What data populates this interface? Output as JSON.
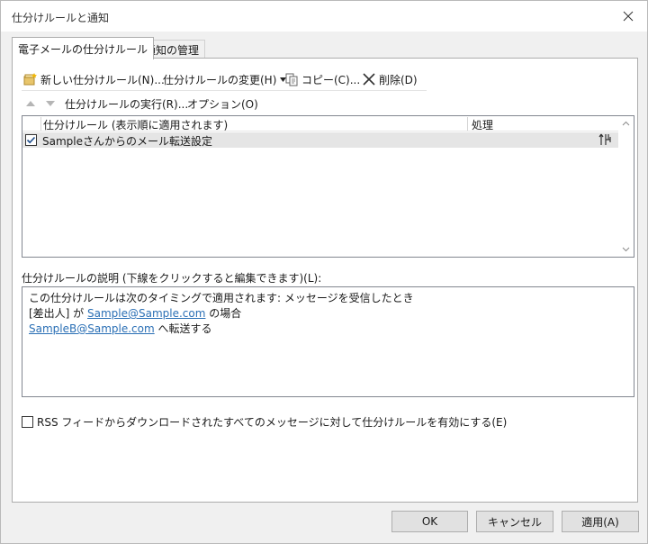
{
  "window": {
    "title": "仕分けルールと通知"
  },
  "tabs": [
    {
      "label": "電子メールの仕分けルール",
      "active": true
    },
    {
      "label": "通知の管理",
      "active": false
    }
  ],
  "toolbar": {
    "new_rule": "新しい仕分けルール(N)...",
    "change_rule": "仕分けルールの変更(H)",
    "copy": "コピー(C)...",
    "delete": "削除(D)",
    "run_rules": "仕分けルールの実行(R)...",
    "options": "オプション(O)"
  },
  "rules_list": {
    "col_rule": "仕分けルール (表示順に適用されます)",
    "col_action": "処理",
    "rows": [
      {
        "label": "Sampleさんからのメール転送設定",
        "checked": true
      }
    ]
  },
  "description": {
    "label": "仕分けルールの説明 (下線をクリックすると編集できます)(L):",
    "line1": "この仕分けルールは次のタイミングで適用されます: メッセージを受信したとき",
    "line2_prefix": "[差出人] が ",
    "line2_link": "Sample@Sample.com",
    "line2_suffix": " の場合",
    "line3_link": "SampleB@Sample.com",
    "line3_suffix": " へ転送する"
  },
  "rss": {
    "label": "RSS フィードからダウンロードされたすべてのメッセージに対して仕分けルールを有効にする(E)",
    "checked": false
  },
  "buttons": {
    "ok": "OK",
    "cancel": "キャンセル",
    "apply": "適用(A)"
  },
  "colors": {
    "link": "#2a6fb5",
    "selected_row": "#e5e5e5",
    "dialog_bg": "#f0f0f0"
  }
}
